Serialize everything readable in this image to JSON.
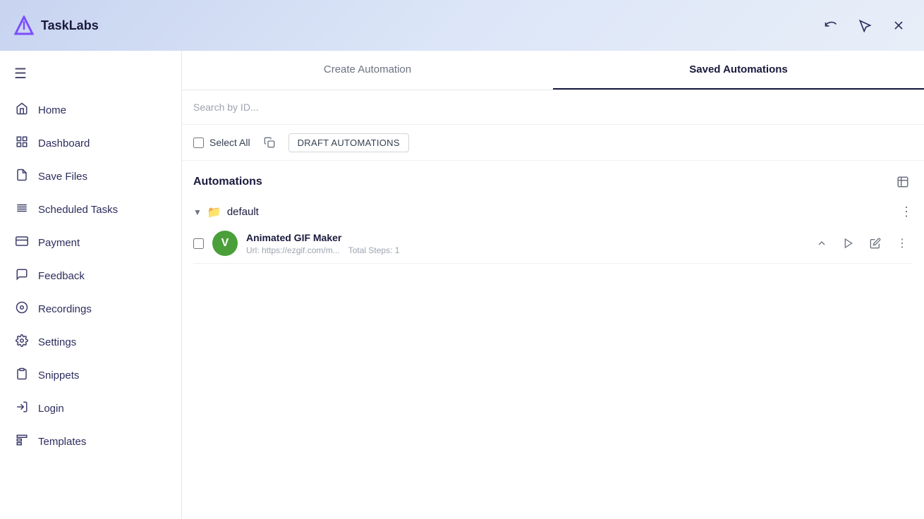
{
  "app": {
    "name": "TaskLabs",
    "logo_color": "#7c4dff"
  },
  "topbar": {
    "title": "TaskLabs",
    "actions": [
      "undo",
      "cursor",
      "close"
    ]
  },
  "sidebar": {
    "menu_icon": "☰",
    "items": [
      {
        "id": "home",
        "label": "Home",
        "icon": "🏠"
      },
      {
        "id": "dashboard",
        "label": "Dashboard",
        "icon": "⊞"
      },
      {
        "id": "save-files",
        "label": "Save Files",
        "icon": "📄"
      },
      {
        "id": "scheduled-tasks",
        "label": "Scheduled Tasks",
        "icon": "☰"
      },
      {
        "id": "payment",
        "label": "Payment",
        "icon": "💳"
      },
      {
        "id": "feedback",
        "label": "Feedback",
        "icon": "💬"
      },
      {
        "id": "recordings",
        "label": "Recordings",
        "icon": "⏺"
      },
      {
        "id": "settings",
        "label": "Settings",
        "icon": "⚙"
      },
      {
        "id": "snippets",
        "label": "Snippets",
        "icon": "📋"
      },
      {
        "id": "login",
        "label": "Login",
        "icon": "→"
      },
      {
        "id": "templates",
        "label": "Templates",
        "icon": "⊟"
      }
    ]
  },
  "tabs": [
    {
      "id": "create",
      "label": "Create Automation",
      "active": false
    },
    {
      "id": "saved",
      "label": "Saved Automations",
      "active": true
    }
  ],
  "search": {
    "placeholder": "Search by ID..."
  },
  "toolbar": {
    "select_all_label": "Select All",
    "draft_button": "DRAFT AUTOMATIONS"
  },
  "automations": {
    "section_title": "Automations",
    "folder": {
      "name": "default",
      "expanded": true
    },
    "items": [
      {
        "id": "animated-gif-maker",
        "name": "Animated GIF Maker",
        "url": "Url: https://ezgif.com/m...",
        "total_steps": "Total Steps: 1",
        "avatar_letter": "V",
        "avatar_color": "#4a9f3a"
      }
    ]
  }
}
